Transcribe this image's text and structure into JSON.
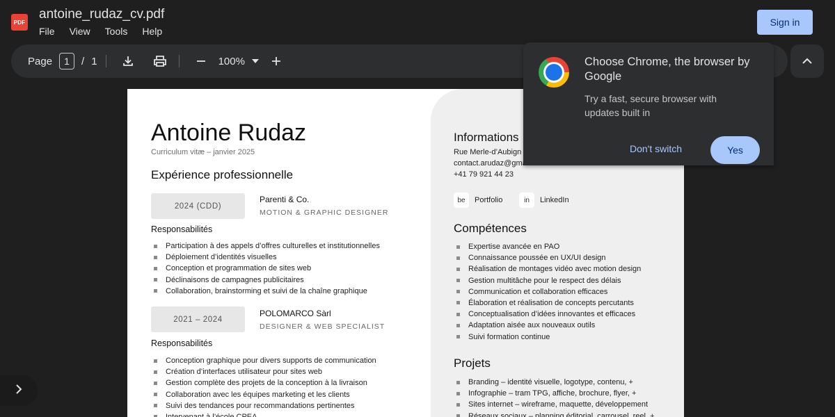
{
  "header": {
    "pdf_icon_text": "PDF",
    "file_name": "antoine_rudaz_cv.pdf",
    "menu": [
      "File",
      "View",
      "Tools",
      "Help"
    ],
    "sign_in": "Sign in"
  },
  "toolbar": {
    "page_label": "Page",
    "current_page": "1",
    "page_sep": "/",
    "total_pages": "1",
    "zoom": "100%",
    "icons": [
      "download-icon",
      "print-icon",
      "zoom-out-icon",
      "dropdown-icon",
      "zoom-in-icon",
      "chevron-up-icon"
    ]
  },
  "popup": {
    "title": "Choose Chrome, the browser by Google",
    "text": "Try a fast, secure browser with updates built in",
    "dont_switch": "Don't switch",
    "yes": "Yes"
  },
  "cv": {
    "name": "Antoine Rudaz",
    "subtitle": "Curriculum vitæ – janvier 2025",
    "experience_title": "Expérience professionnelle",
    "jobs": [
      {
        "dates": "2024 (CDD)",
        "company": "Parenti & Co.",
        "role": "MOTION & GRAPHIC DESIGNER",
        "resp_label": "Responsabilités",
        "items": [
          "Participation à des appels d’offres culturelles et institutionnelles",
          "Déploiement d’identités visuelles",
          "Conception et programmation de sites web",
          "Déclinaisons de campagnes publicitaires",
          "Collaboration, brainstorming et suivi de la chaîne graphique"
        ]
      },
      {
        "dates": "2021 – 2024",
        "company": "POLOMARCO Sàrl",
        "role": "DESIGNER & WEB SPECIALIST",
        "resp_label": "Responsabilités",
        "items": [
          "Conception graphique pour divers supports de communication",
          "Création d’interfaces utilisateur pour sites web",
          "Gestion complète des projets de la conception à la livraison",
          "Collaboration avec les équipes marketing et les clients",
          "Suivi des tendances pour recommandations pertinentes",
          "Intervenant à l’école CPEA"
        ]
      }
    ],
    "info_title": "Informations",
    "info_lines": [
      "Rue Merle-d’Aubign",
      "contact.arudaz@gmail.com",
      "+41 79 921 44 23"
    ],
    "links": [
      {
        "icon": "be",
        "label": "Portfolio"
      },
      {
        "icon": "in",
        "label": "LinkedIn"
      }
    ],
    "skills_title": "Compétences",
    "skills": [
      "Expertise avancée en PAO",
      "Connaissance poussée en UX/UI design",
      "Réalisation de montages vidéo avec motion design",
      "Gestion multitâche pour le respect des délais",
      "Communication et collaboration efficaces",
      "Élaboration et réalisation de concepts percutants",
      "Conceptualisation d’idées innovantes et efficaces",
      "Adaptation aisée aux nouveaux outils",
      "Suivi formation continue"
    ],
    "projects_title": "Projets",
    "projects": [
      "Branding – identité visuelle, logotype, contenu, +",
      "Infographie – tram TPG, affiche, brochure, flyer, +",
      "Sites internet – wireframe, maquette, développement",
      "Réseaux sociaux – planning éditorial, carrousel, reel, +"
    ]
  }
}
